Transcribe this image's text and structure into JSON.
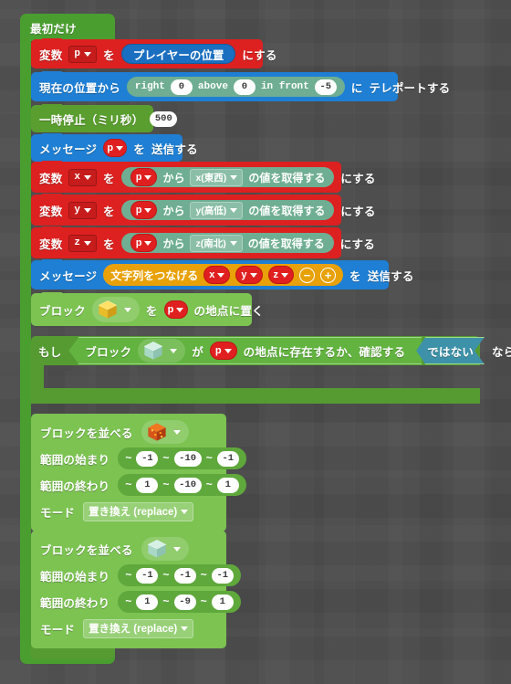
{
  "editor": {
    "name": "block-coding-workspace",
    "background_color": "#4b4b4b"
  },
  "palette": {
    "event_green": "#4a9e2f",
    "variable_red": "#dd2020",
    "message_blue": "#1e7fd4",
    "position_sage": "#6fae92",
    "loops_green": "#559b32",
    "blocks_lime": "#7cc352",
    "text_orange": "#e8a108",
    "logic_teal": "#3d91a8",
    "number_white": "#ffffff"
  },
  "hat": {
    "label": "最初だけ"
  },
  "blocks": {
    "set_p": {
      "prefix": "変数",
      "variable": "p",
      "connector": "を",
      "value": "プレイヤーの位置",
      "suffix": "にする"
    },
    "teleport": {
      "prefix": "現在の位置から",
      "right_label": "right",
      "right_value": "0",
      "above_label": "above",
      "above_value": "0",
      "front_label": "in front",
      "front_value": "-5",
      "mid": "に",
      "suffix": "テレポートする"
    },
    "pause": {
      "label": "一時停止（ミリ秒）",
      "value": "500"
    },
    "say_p": {
      "prefix": "メッセージ",
      "variable": "p",
      "connector": "を",
      "suffix": "送信する"
    },
    "get_x": {
      "prefix": "変数",
      "variable": "x",
      "connector": "を",
      "source": "p",
      "from": "から",
      "axis": "x(東西)",
      "getter": "の値を取得する",
      "suffix": "にする"
    },
    "get_y": {
      "prefix": "変数",
      "variable": "y",
      "connector": "を",
      "source": "p",
      "from": "から",
      "axis": "y(高低)",
      "getter": "の値を取得する",
      "suffix": "にする"
    },
    "get_z": {
      "prefix": "変数",
      "variable": "z",
      "connector": "を",
      "source": "p",
      "from": "から",
      "axis": "z(南北)",
      "getter": "の値を取得する",
      "suffix": "にする"
    },
    "say_join": {
      "prefix": "メッセージ",
      "join_label": "文字列をつなげる",
      "args": [
        "x",
        "y",
        "z"
      ],
      "minus": "−",
      "plus": "+",
      "connector": "を",
      "suffix": "送信する"
    },
    "place": {
      "prefix": "ブロック",
      "block_icon": "gold-block-icon",
      "connector": "を",
      "target": "p",
      "suffix": "の地点に置く"
    },
    "repeat_until": {
      "if_label": "もし",
      "test_prefix": "ブロック",
      "test_icon": "diamond-block-icon",
      "test_mid": "が",
      "test_target": "p",
      "test_suffix": "の地点に存在するか、確認する",
      "not_label": "ではない",
      "tail": "ならくりかえし"
    },
    "fill_1": {
      "label": "ブロックを並べる",
      "block_icon": "magma-block-icon",
      "from_label": "範囲の始まり",
      "from_values": [
        "-1",
        "-10",
        "-1"
      ],
      "to_label": "範囲の終わり",
      "to_values": [
        "1",
        "-10",
        "1"
      ],
      "mode_label": "モード",
      "mode_value": "置き換え (replace)",
      "tilde": "~"
    },
    "fill_2": {
      "label": "ブロックを並べる",
      "block_icon": "diamond-block-icon",
      "from_label": "範囲の始まり",
      "from_values": [
        "-1",
        "-1",
        "-1"
      ],
      "to_label": "範囲の終わり",
      "to_values": [
        "1",
        "-9",
        "1"
      ],
      "mode_label": "モード",
      "mode_value": "置き換え (replace)",
      "tilde": "~"
    }
  }
}
